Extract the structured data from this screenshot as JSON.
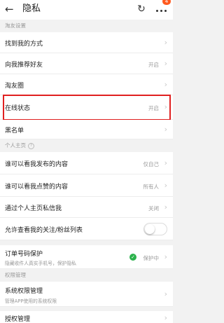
{
  "header": {
    "title": "隐私",
    "badge": "4"
  },
  "sections": {
    "friends": "淘友设置",
    "homepage": "个人主页",
    "permissions": "权限管理"
  },
  "rows": {
    "find_me": {
      "label": "找到我的方式"
    },
    "recommend": {
      "label": "向我推荐好友",
      "value": "开启"
    },
    "circle": {
      "label": "淘友圈"
    },
    "online": {
      "label": "在线状态",
      "value": "开启"
    },
    "blacklist": {
      "label": "黑名单"
    },
    "posts": {
      "label": "谁可以看我发布的内容",
      "value": "仅自己"
    },
    "likes": {
      "label": "谁可以看我点赞的内容",
      "value": "所有人"
    },
    "dm": {
      "label": "通过个人主页私信我",
      "value": "关闭"
    },
    "follow": {
      "label": "允许查看我的关注/粉丝列表",
      "toggle_on": false
    },
    "order": {
      "label": "订单号码保护",
      "sub": "隐藏收件人真实手机号，保护隐私",
      "value": "保护中"
    },
    "system": {
      "label": "系统权限管理",
      "sub": "管理APP使用的系统权限"
    },
    "auth": {
      "label": "授权管理"
    }
  },
  "icons": {
    "back": "back-arrow-icon",
    "refresh": "refresh-icon",
    "more": "more-icon",
    "info": "info-icon",
    "chevron": "chevron-right-icon",
    "shield": "shield-check-icon"
  },
  "colors": {
    "highlight": "#e02020",
    "badge": "#ff5a1f",
    "protect": "#2bb24c"
  }
}
